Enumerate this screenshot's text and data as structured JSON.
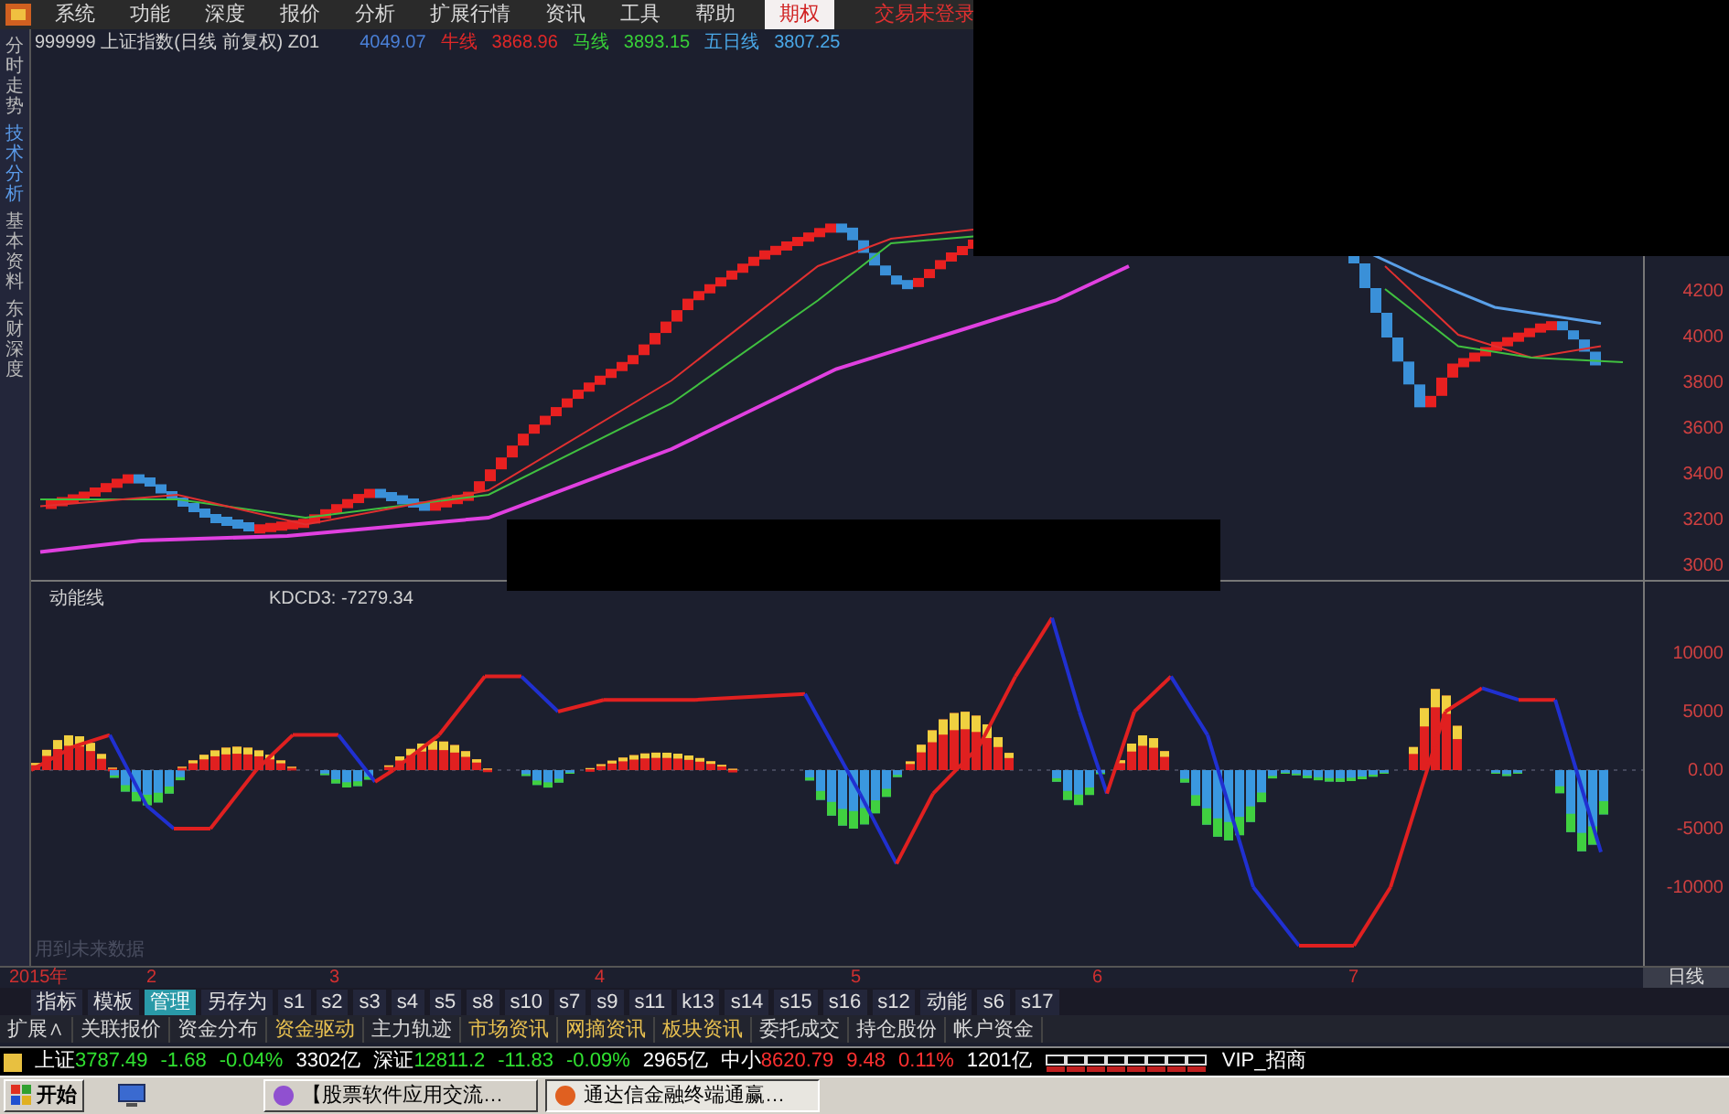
{
  "menu": [
    {
      "label": "系统"
    },
    {
      "label": "功能"
    },
    {
      "label": "深度"
    },
    {
      "label": "报价"
    },
    {
      "label": "分析"
    },
    {
      "label": "扩展行情"
    },
    {
      "label": "资讯"
    },
    {
      "label": "工具"
    },
    {
      "label": "帮助"
    }
  ],
  "option_tab": {
    "label": "期权"
  },
  "login_status": "交易未登录",
  "quote_header": {
    "symbol": "999999 上证指数(日线 前复权) Z01",
    "value": "4049.07",
    "lines": [
      {
        "label": "牛线",
        "value": "3868.96",
        "color": "#e02828"
      },
      {
        "label": "马线",
        "value": "3893.15",
        "color": "#38d038"
      },
      {
        "label": "五日线",
        "value": "3807.25",
        "color": "#4aa8e8"
      }
    ]
  },
  "side_tabs": [
    {
      "label": "分时走势",
      "selected": false
    },
    {
      "label": "技术分析",
      "selected": true
    },
    {
      "label": "基本资料",
      "selected": false
    },
    {
      "label": "东财深度",
      "selected": false
    }
  ],
  "price_axis": [
    "4200",
    "4000",
    "3800",
    "3600",
    "3400",
    "3200",
    "3000"
  ],
  "indicator": {
    "name": "动能线",
    "reading": "KDCD3: -7279.34",
    "axis": [
      "10000",
      "5000",
      "0.00",
      "-5000",
      "-10000"
    ],
    "note": "用到未来数据"
  },
  "timeline": [
    "2015年",
    "2",
    "3",
    "4",
    "5",
    "6",
    "7"
  ],
  "period": "日线",
  "formula_tabs": [
    {
      "label": "指标",
      "selected": false
    },
    {
      "label": "模板",
      "selected": false
    },
    {
      "label": "管理",
      "selected": true
    },
    {
      "label": "另存为",
      "selected": false
    },
    {
      "label": "s1",
      "selected": false
    },
    {
      "label": "s2",
      "selected": false
    },
    {
      "label": "s3",
      "selected": false
    },
    {
      "label": "s4",
      "selected": false
    },
    {
      "label": "s5",
      "selected": false
    },
    {
      "label": "s8",
      "selected": false
    },
    {
      "label": "s10",
      "selected": false
    },
    {
      "label": "s7",
      "selected": false
    },
    {
      "label": "s9",
      "selected": false
    },
    {
      "label": "s11",
      "selected": false
    },
    {
      "label": "k13",
      "selected": false
    },
    {
      "label": "s14",
      "selected": false
    },
    {
      "label": "s15",
      "selected": false
    },
    {
      "label": "s16",
      "selected": false
    },
    {
      "label": "s12",
      "selected": false
    },
    {
      "label": "动能",
      "selected": false
    },
    {
      "label": "s6",
      "selected": false
    },
    {
      "label": "s17",
      "selected": false
    }
  ],
  "function_tabs": [
    {
      "label": "扩展∧",
      "highlighted": false
    },
    {
      "label": "关联报价",
      "highlighted": false
    },
    {
      "label": "资金分布",
      "highlighted": false
    },
    {
      "label": "资金驱动",
      "highlighted": true
    },
    {
      "label": "主力轨迹",
      "highlighted": false
    },
    {
      "label": "市场资讯",
      "highlighted": true
    },
    {
      "label": "网摘资讯",
      "highlighted": true
    },
    {
      "label": "板块资讯",
      "highlighted": true
    },
    {
      "label": "委托成交",
      "highlighted": false
    },
    {
      "label": "持仓股份",
      "highlighted": false
    },
    {
      "label": "帐户资金",
      "highlighted": false
    }
  ],
  "market_bar": {
    "indices": [
      {
        "name": "上证",
        "price": "3787.49",
        "change": "-1.68",
        "percent": "-0.04%",
        "volume": "3302亿",
        "rising": false
      },
      {
        "name": "深证",
        "price": "12811.2",
        "change": "-11.83",
        "percent": "-0.09%",
        "volume": "2965亿",
        "rising": false
      },
      {
        "name": "中小",
        "price": "8620.79",
        "change": "9.48",
        "percent": "0.11%",
        "volume": "1201亿",
        "rising": true
      }
    ],
    "account": "VIP_招商"
  },
  "taskbar": {
    "start": "开始",
    "windows": [
      {
        "label": "【股票软件应用交流…",
        "selected": false
      },
      {
        "label": "通达信金融终端通赢…",
        "selected": true
      }
    ]
  }
}
